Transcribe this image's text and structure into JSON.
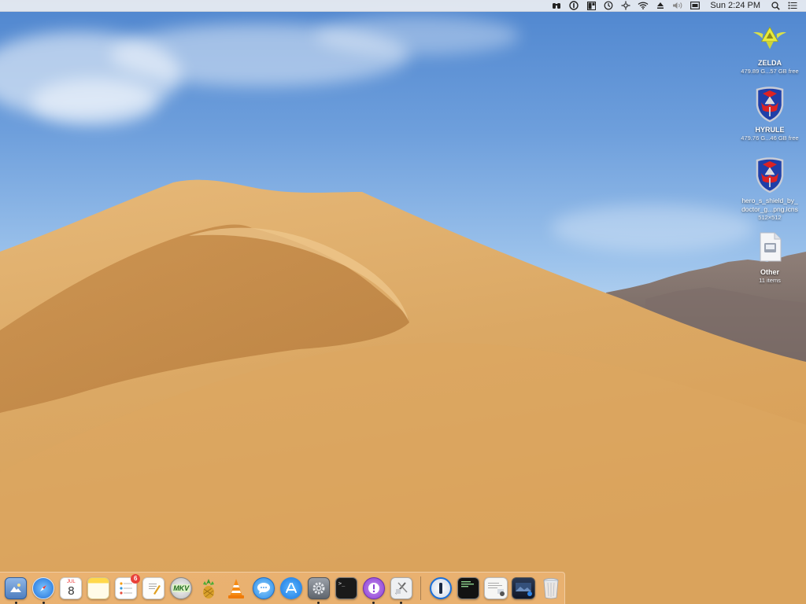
{
  "menubar": {
    "items": [
      {
        "icon": "binoculars-icon"
      },
      {
        "icon": "password-manager-icon"
      },
      {
        "icon": "window-layout-icon"
      },
      {
        "icon": "time-machine-icon"
      },
      {
        "icon": "bluetooth-like-icon"
      },
      {
        "icon": "wifi-icon"
      },
      {
        "icon": "eject-icon"
      },
      {
        "icon": "volume-icon"
      },
      {
        "icon": "display-icon"
      }
    ],
    "clock": "Sun 2:24 PM",
    "right_icons": [
      {
        "icon": "spotlight-search-icon"
      },
      {
        "icon": "notification-center-icon"
      }
    ]
  },
  "desktop_icons": [
    {
      "name": "ZELDA",
      "sub": "479.89 G...57 GB free",
      "icon": "triforce-crest-icon"
    },
    {
      "name": "HYRULE",
      "sub": "479.76 G...46 GB free",
      "icon": "hylian-shield-icon"
    },
    {
      "name": "hero_s_shield_by_doctor_g...png.icns",
      "name_line1": "hero_s_shield_by_",
      "name_line2": "doctor_g...png.icns",
      "sub": "512×512",
      "icon": "hylian-shield-icon"
    },
    {
      "name": "Other",
      "sub": "11 items",
      "icon": "document-icon"
    }
  ],
  "dock": {
    "apps": [
      {
        "label": "Preview",
        "icon": "preview-icon",
        "running": true
      },
      {
        "label": "Safari",
        "icon": "safari-compass-icon",
        "running": true
      },
      {
        "label": "Calendar",
        "icon": "calendar-icon",
        "month": "JUL",
        "day": "8",
        "running": false
      },
      {
        "label": "Notes",
        "icon": "notes-icon",
        "running": false
      },
      {
        "label": "Reminders",
        "icon": "reminders-icon",
        "badge": "6",
        "running": false
      },
      {
        "label": "TextEdit",
        "icon": "textedit-icon",
        "running": false
      },
      {
        "label": "MKV Tools",
        "icon": "mkv-icon",
        "text": "MKV",
        "running": false
      },
      {
        "label": "Pineapple App",
        "icon": "pineapple-icon",
        "running": false
      },
      {
        "label": "VLC",
        "icon": "vlc-cone-icon",
        "running": false
      },
      {
        "label": "Messages",
        "icon": "messages-icon",
        "running": false
      },
      {
        "label": "App Store",
        "icon": "app-store-icon",
        "running": false
      },
      {
        "label": "System Preferences",
        "icon": "gear-icon",
        "running": true
      },
      {
        "label": "Terminal",
        "icon": "terminal-icon",
        "text": ">_",
        "running": false
      },
      {
        "label": "Feedback Assistant",
        "icon": "feedback-icon",
        "running": true
      },
      {
        "label": "Xcode Tools",
        "icon": "xcode-tools-icon",
        "running": true
      }
    ],
    "others": [
      {
        "label": "1Password",
        "icon": "onepassword-icon",
        "running": false
      },
      {
        "label": "Console",
        "icon": "console-icon",
        "running": false
      },
      {
        "label": "Document Folder",
        "icon": "document-stack-icon",
        "running": false
      },
      {
        "label": "Screenshot",
        "icon": "screen-capture-icon",
        "running": false
      },
      {
        "label": "Trash",
        "icon": "trash-icon",
        "running": false
      }
    ]
  },
  "colors": {
    "sky_top": "#4f86cf",
    "sand": "#d9a55f",
    "dock_tint": "#f5be82",
    "badge": "#e9413a"
  }
}
